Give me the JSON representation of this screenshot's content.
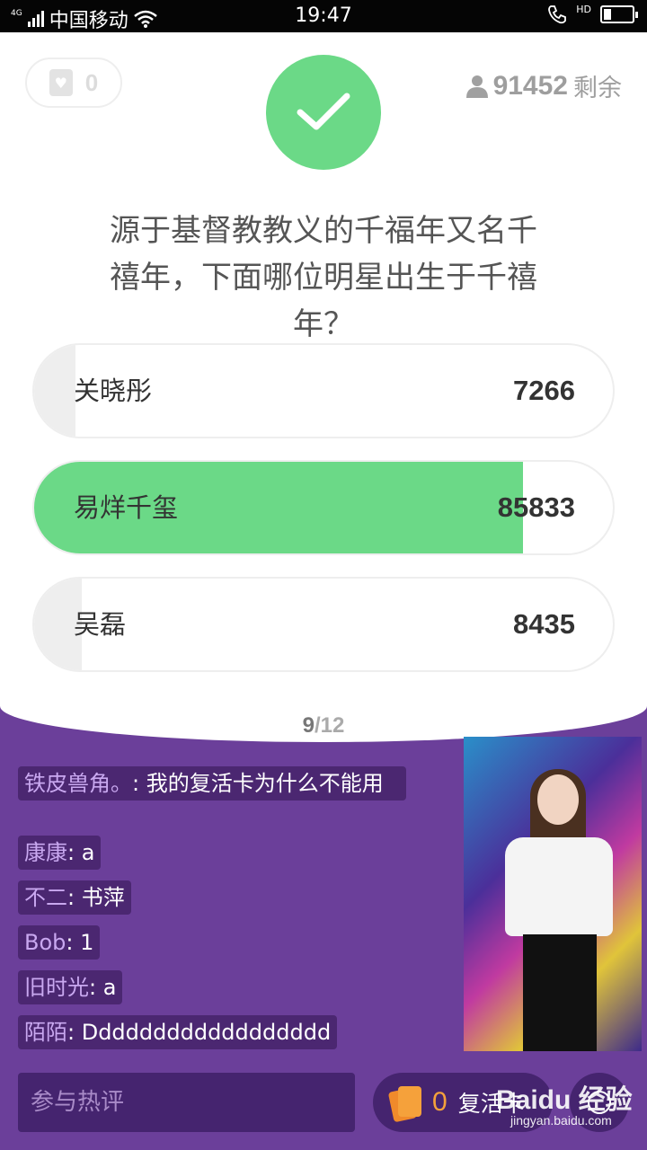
{
  "status_bar": {
    "network": "4G",
    "carrier": "中国移动",
    "time": "19:47",
    "hd": "HD",
    "battery_level": 0.25
  },
  "header": {
    "lives_count": "0",
    "remaining_count": "91452",
    "remaining_label": "剩余"
  },
  "question": {
    "text": "源于基督教教义的千福年又名千禧年，下面哪位明星出生于千禧年？",
    "progress_current": "9",
    "progress_separator": "/",
    "progress_total": "12"
  },
  "options": [
    {
      "label": "关晓彤",
      "votes": "7266",
      "fill": 0.0707,
      "correct": false
    },
    {
      "label": "易烊千玺",
      "votes": "85833",
      "fill": 0.844,
      "correct": true
    },
    {
      "label": "吴磊",
      "votes": "8435",
      "fill": 0.082,
      "correct": false
    }
  ],
  "colors": {
    "correct_green": "#6bd987",
    "option_gray": "#eeeeee",
    "background_purple": "#6b3f9a"
  },
  "chat": [
    {
      "user": "铁皮兽角。",
      "message": "我的复活卡为什么不能用"
    },
    {
      "user": "康康",
      "message": "a"
    },
    {
      "user": "不二",
      "message": "书萍"
    },
    {
      "user": "Bob",
      "message": "1"
    },
    {
      "user": "旧时光",
      "message": "a"
    },
    {
      "user": "陌陌",
      "message": "Dddddddddddddddddd"
    }
  ],
  "chat_separator": ": ",
  "bottom_bar": {
    "comment_placeholder": "参与热评",
    "revive_count": "0",
    "revive_label": "复活卡"
  },
  "watermark": {
    "logo": "Baidu 经验",
    "url": "jingyan.baidu.com"
  }
}
